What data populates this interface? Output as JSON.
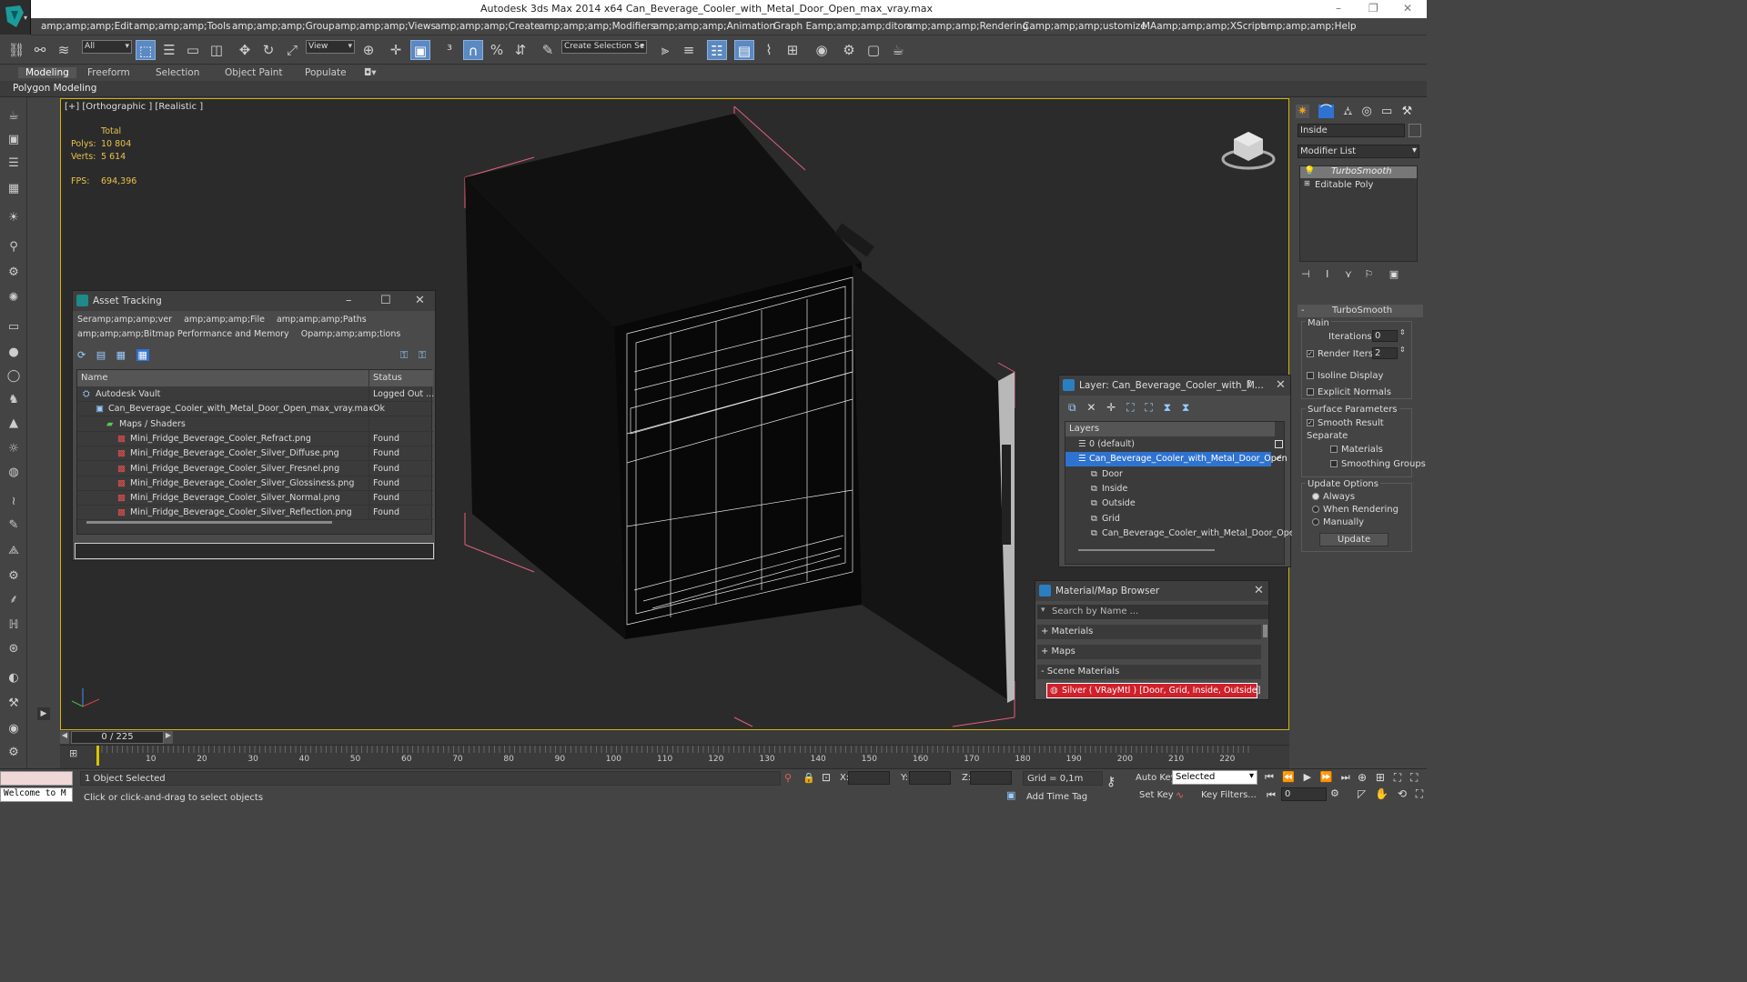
{
  "app": {
    "title": "Autodesk 3ds Max  2014 x64    Can_Beverage_Cooler_with_Metal_Door_Open_max_vray.max",
    "window_controls": [
      "–",
      "❐",
      "✕"
    ]
  },
  "menu": [
    "amp;amp;amp;Edit",
    "amp;amp;amp;Tools",
    "amp;amp;amp;Group",
    "amp;amp;amp;Views",
    "amp;amp;amp;Create",
    "amp;amp;amp;Modifiers",
    "amp;amp;amp;Animation",
    "Graph Eamp;amp;amp;ditors",
    "amp;amp;amp;Rendering",
    "Camp;amp;amp;ustomize",
    "MAamp;amp;amp;XScript",
    "amp;amp;amp;Help"
  ],
  "toolbar": {
    "filter": "All",
    "view": "View",
    "selection_set": "Create Selection Se"
  },
  "ribbon": {
    "tabs": [
      "Modeling",
      "Freeform",
      "Selection",
      "Object Paint",
      "Populate"
    ],
    "sub": "Polygon Modeling"
  },
  "viewport": {
    "label": "[+] [Orthographic ] [Realistic ]",
    "total_label": "Total",
    "polys_label": "Polys:",
    "polys": "10 804",
    "verts_label": "Verts:",
    "verts": "5 614",
    "fps_label": "FPS:",
    "fps": "694,396"
  },
  "asset_tracking": {
    "title": "Asset Tracking",
    "menu1": [
      "Seramp;amp;amp;ver",
      "amp;amp;amp;File",
      "amp;amp;amp;Paths"
    ],
    "menu2": [
      "amp;amp;amp;Bitmap Performance and Memory",
      "Opamp;amp;amp;tions"
    ],
    "col_name": "Name",
    "col_status": "Status",
    "rows": [
      {
        "name": "Autodesk Vault",
        "status": "Logged Out ..."
      },
      {
        "name": "Can_Beverage_Cooler_with_Metal_Door_Open_max_vray.max",
        "status": "Ok"
      },
      {
        "name": "Maps / Shaders",
        "status": ""
      },
      {
        "name": "Mini_Fridge_Beverage_Cooler_Refract.png",
        "status": "Found"
      },
      {
        "name": "Mini_Fridge_Beverage_Cooler_Silver_Diffuse.png",
        "status": "Found"
      },
      {
        "name": "Mini_Fridge_Beverage_Cooler_Silver_Fresnel.png",
        "status": "Found"
      },
      {
        "name": "Mini_Fridge_Beverage_Cooler_Silver_Glossiness.png",
        "status": "Found"
      },
      {
        "name": "Mini_Fridge_Beverage_Cooler_Silver_Normal.png",
        "status": "Found"
      },
      {
        "name": "Mini_Fridge_Beverage_Cooler_Silver_Reflection.png",
        "status": "Found"
      }
    ]
  },
  "layer": {
    "title": "Layer: Can_Beverage_Cooler_with_M...",
    "help": "?",
    "header": "Layers",
    "rows": [
      {
        "name": "0 (default)"
      },
      {
        "name": "Can_Beverage_Cooler_with_Metal_Door_Open"
      },
      {
        "name": "Door"
      },
      {
        "name": "Inside"
      },
      {
        "name": "Outside"
      },
      {
        "name": "Grid"
      },
      {
        "name": "Can_Beverage_Cooler_with_Metal_Door_Open"
      }
    ]
  },
  "material_browser": {
    "title": "Material/Map Browser",
    "search_placeholder": "Search by Name ...",
    "sections": [
      "+ Materials",
      "+ Maps",
      "- Scene Materials"
    ],
    "item": "Silver  ( VRayMtl )  [Door, Grid, Inside, Outside]"
  },
  "command_panel": {
    "object_name": "Inside",
    "modifier_list": "Modifier List",
    "stack": [
      "TurboSmooth",
      "Editable Poly"
    ],
    "rollout": "TurboSmooth",
    "main": "Main",
    "iterations_label": "Iterations:",
    "iterations": "0",
    "render_iters_label": "Render Iters:",
    "render_iters": "2",
    "isoline": "Isoline Display",
    "explicit": "Explicit Normals",
    "surface_params": "Surface Parameters",
    "smooth_result": "Smooth Result",
    "separate": "Separate",
    "materials": "Materials",
    "smoothing_groups": "Smoothing Groups",
    "update_options": "Update Options",
    "always": "Always",
    "when_rendering": "When Rendering",
    "manually": "Manually",
    "update_btn": "Update"
  },
  "timeline": {
    "frame": "0 / 225",
    "ticks": [
      "10",
      "20",
      "30",
      "40",
      "50",
      "60",
      "70",
      "80",
      "90",
      "100",
      "110",
      "120",
      "130",
      "140",
      "150",
      "160",
      "170",
      "180",
      "190",
      "200",
      "210",
      "220"
    ]
  },
  "status": {
    "welcome": "Welcome to M",
    "selected": "1 Object Selected",
    "hint": "Click or click-and-drag to select objects",
    "x_label": "X:",
    "y_label": "Y:",
    "z_label": "Z:",
    "grid": "Grid = 0,1m",
    "add_time_tag": "Add Time Tag",
    "auto_key": "Auto Key",
    "set_key": "Set Key",
    "selected_dd": "Selected",
    "key_filters": "Key Filters...",
    "frame_field": "0"
  }
}
